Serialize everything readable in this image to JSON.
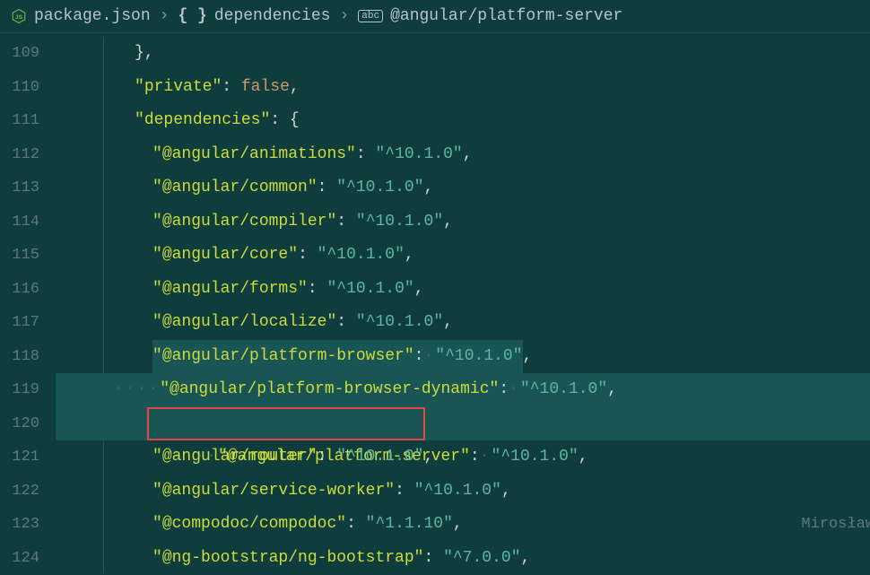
{
  "breadcrumb": {
    "file": "package.json",
    "section": "dependencies",
    "property": "@angular/platform-server"
  },
  "lines": {
    "start": 109,
    "l109": "},",
    "l110_key": "private",
    "l110_val": "false",
    "l111_key": "dependencies",
    "l112_key": "@angular/animations",
    "l112_val": "^10.1.0",
    "l113_key": "@angular/common",
    "l113_val": "^10.1.0",
    "l114_key": "@angular/compiler",
    "l114_val": "^10.1.0",
    "l115_key": "@angular/core",
    "l115_val": "^10.1.0",
    "l116_key": "@angular/forms",
    "l116_val": "^10.1.0",
    "l117_key": "@angular/localize",
    "l117_val": "^10.1.0",
    "l118_key": "@angular/platform-browser",
    "l118_val": "^10.1.0",
    "l119_key": "@angular/platform-browser-dynamic",
    "l119_val": "^10.1.0",
    "l120_key": "@angular/platform-server",
    "l120_val": "^10.1.0",
    "l121_key": "@angular/router",
    "l121_val": "^10.1.0",
    "l122_key": "@angular/service-worker",
    "l122_val": "^10.1.0",
    "l123_key": "@compodoc/compodoc",
    "l123_val": "^1.1.10",
    "l124_key": "@ng-bootstrap/ng-bootstrap",
    "l124_val": "^7.0.0"
  },
  "blame": "Mirosław",
  "line_numbers": [
    "109",
    "110",
    "111",
    "112",
    "113",
    "114",
    "115",
    "116",
    "117",
    "118",
    "119",
    "120",
    "121",
    "122",
    "123",
    "124"
  ]
}
